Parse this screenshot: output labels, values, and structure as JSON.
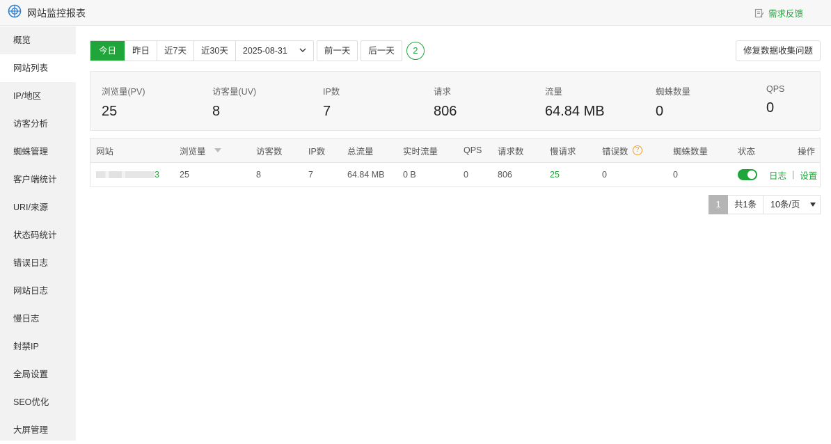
{
  "app": {
    "title": "网站监控报表",
    "feedback_label": "需求反馈"
  },
  "sidebar": {
    "items": [
      {
        "label": "概览"
      },
      {
        "label": "网站列表",
        "active": true
      },
      {
        "label": "IP/地区"
      },
      {
        "label": "访客分析"
      },
      {
        "label": "蜘蛛管理"
      },
      {
        "label": "客户端统计"
      },
      {
        "label": "URI/来源"
      },
      {
        "label": "状态码统计"
      },
      {
        "label": "错误日志"
      },
      {
        "label": "网站日志"
      },
      {
        "label": "慢日志"
      },
      {
        "label": "封禁IP"
      },
      {
        "label": "全局设置"
      },
      {
        "label": "SEO优化"
      },
      {
        "label": "大屏管理"
      }
    ]
  },
  "toolbar": {
    "range_tabs": [
      "今日",
      "昨日",
      "近7天",
      "近30天"
    ],
    "active_tab": "今日",
    "date_value": "2025-08-31",
    "prev_day": "前一天",
    "next_day": "后一天",
    "circle_badge": "2",
    "repair_button": "修复数据收集问题"
  },
  "stats": [
    {
      "label": "浏览量(PV)",
      "value": "25"
    },
    {
      "label": "访客量(UV)",
      "value": "8"
    },
    {
      "label": "IP数",
      "value": "7"
    },
    {
      "label": "请求",
      "value": "806"
    },
    {
      "label": "流量",
      "value": "64.84 MB"
    },
    {
      "label": "蜘蛛数量",
      "value": "0"
    },
    {
      "label": "QPS",
      "value": "0"
    }
  ],
  "table": {
    "headers": {
      "site": "网站",
      "pv": "浏览量",
      "uv": "访客数",
      "ip": "IP数",
      "traffic": "总流量",
      "realtime": "实时流量",
      "qps": "QPS",
      "requests": "请求数",
      "slow": "慢请求",
      "errors": "错误数",
      "spiders": "蜘蛛数量",
      "status": "状态",
      "ops": "操作"
    },
    "rows": [
      {
        "site_suffix": "3",
        "pv": "25",
        "uv": "8",
        "ip": "7",
        "traffic": "64.84 MB",
        "realtime": "0 B",
        "qps": "0",
        "requests": "806",
        "slow": "25",
        "errors": "0",
        "spiders": "0",
        "enabled": true,
        "op_log": "日志",
        "op_sep": "|",
        "op_settings": "设置"
      }
    ]
  },
  "pager": {
    "current": "1",
    "total_label": "共1条",
    "page_size": "10条/页"
  },
  "colors": {
    "accent": "#20a53a",
    "warn": "#f0a020"
  }
}
